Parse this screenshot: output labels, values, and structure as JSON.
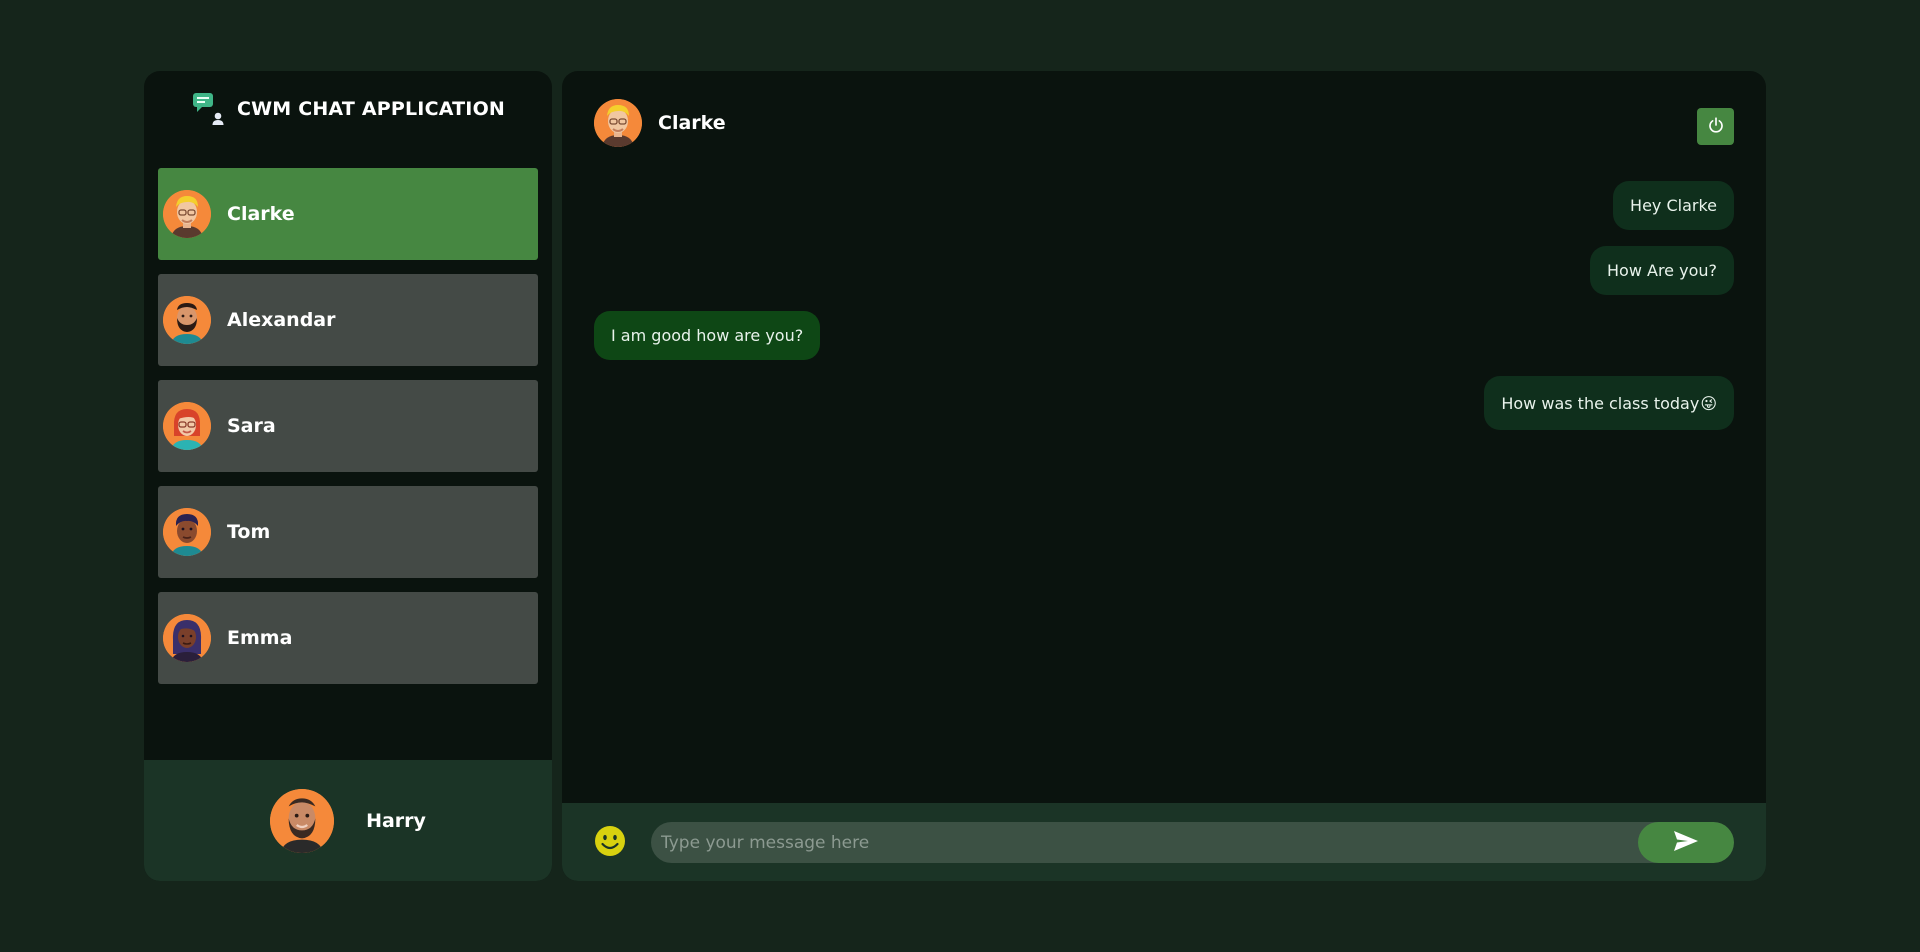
{
  "sidebar": {
    "app_title": "CWM CHAT APPLICATION",
    "contacts": [
      {
        "name": "Clarke",
        "active": true
      },
      {
        "name": "Alexandar",
        "active": false
      },
      {
        "name": "Sara",
        "active": false
      },
      {
        "name": "Tom",
        "active": false
      },
      {
        "name": "Emma",
        "active": false
      }
    ],
    "current_user": {
      "name": "Harry"
    }
  },
  "chat": {
    "contact_name": "Clarke",
    "messages": [
      {
        "direction": "out",
        "text": "Hey Clarke"
      },
      {
        "direction": "out",
        "text": "How Are you?"
      },
      {
        "direction": "in",
        "text": "I am good how are you?"
      },
      {
        "direction": "out",
        "text": "How was the class today",
        "emoji": "😜"
      }
    ],
    "composer": {
      "placeholder": "Type your message here",
      "value": ""
    }
  },
  "icons": {
    "brand": "chat-bubble-user-icon",
    "power": "power-icon",
    "emoji": "smiley-icon",
    "send": "send-arrow-icon"
  },
  "colors": {
    "page_background": "#15251b",
    "panel_background": "#0a130e",
    "accent_green": "#468741",
    "contact_inactive": "#444a46",
    "footer_background": "#1b3426",
    "bubble_outgoing": "#0f2f1c",
    "bubble_incoming": "#0e4715",
    "avatar_orange": "#f5893a",
    "smiley_yellow": "#d8d10f"
  }
}
